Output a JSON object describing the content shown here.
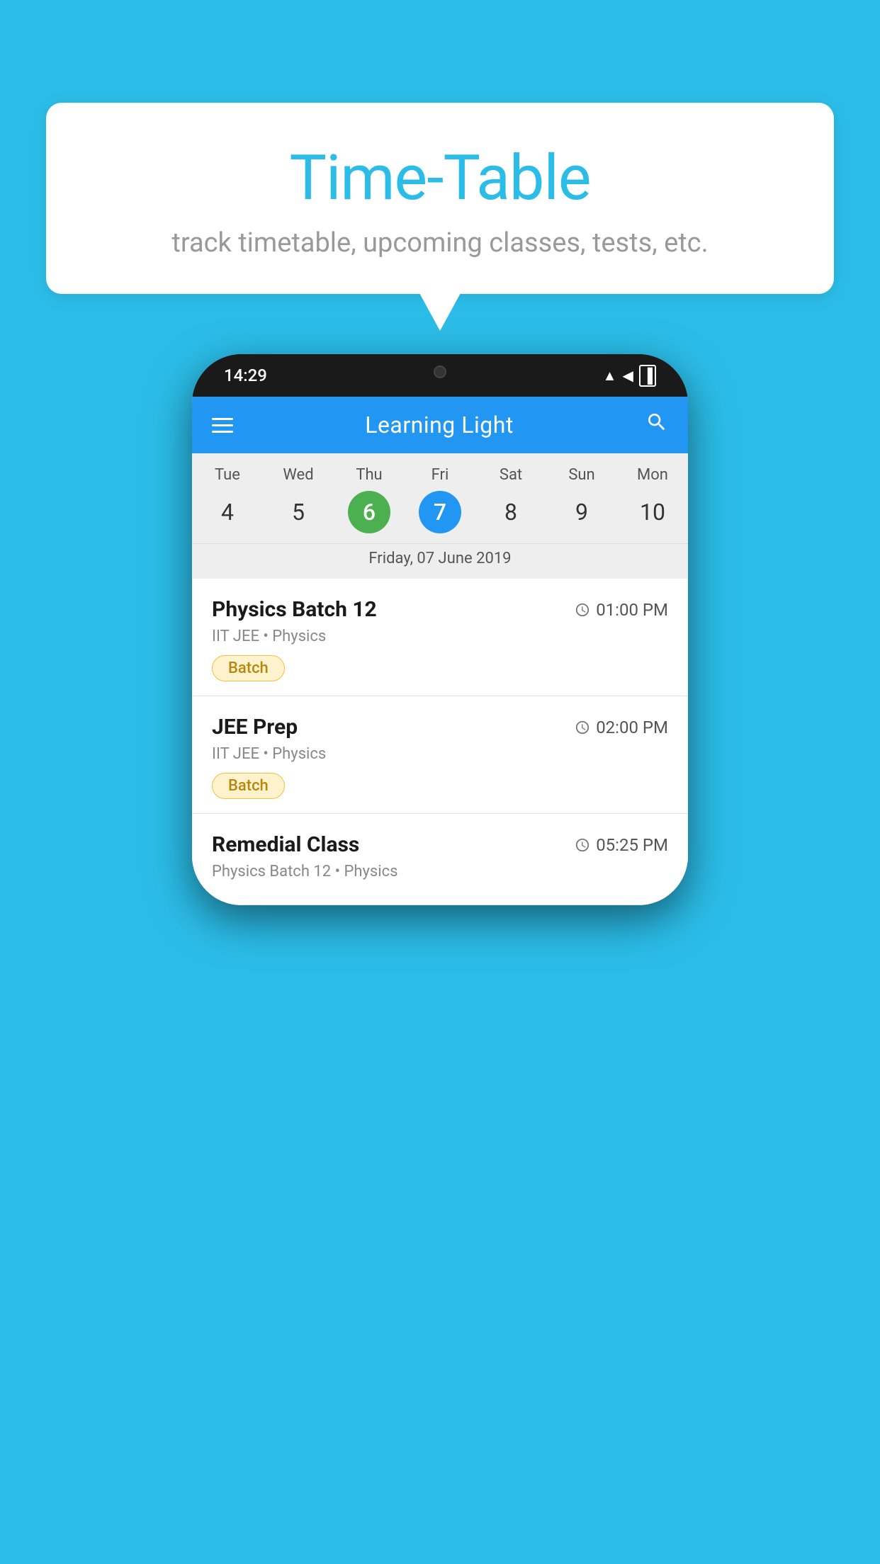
{
  "background_color": "#2BBDE8",
  "bubble": {
    "title": "Time-Table",
    "subtitle": "track timetable, upcoming classes, tests, etc."
  },
  "phone": {
    "status_bar": {
      "time": "14:29",
      "wifi_icon": "▲",
      "signal_icon": "▲",
      "battery_icon": "▐"
    },
    "header": {
      "app_name": "Learning Light",
      "menu_icon": "menu",
      "search_icon": "search"
    },
    "calendar": {
      "days": [
        "Tue",
        "Wed",
        "Thu",
        "Fri",
        "Sat",
        "Sun",
        "Mon"
      ],
      "dates": [
        4,
        5,
        6,
        7,
        8,
        9,
        10
      ],
      "today_index": 2,
      "selected_index": 3,
      "selected_date_label": "Friday, 07 June 2019"
    },
    "schedule": [
      {
        "title": "Physics Batch 12",
        "time": "01:00 PM",
        "meta": "IIT JEE • Physics",
        "badge": "Batch"
      },
      {
        "title": "JEE Prep",
        "time": "02:00 PM",
        "meta": "IIT JEE • Physics",
        "badge": "Batch"
      },
      {
        "title": "Remedial Class",
        "time": "05:25 PM",
        "meta": "Physics Batch 12 • Physics",
        "badge": ""
      }
    ]
  }
}
